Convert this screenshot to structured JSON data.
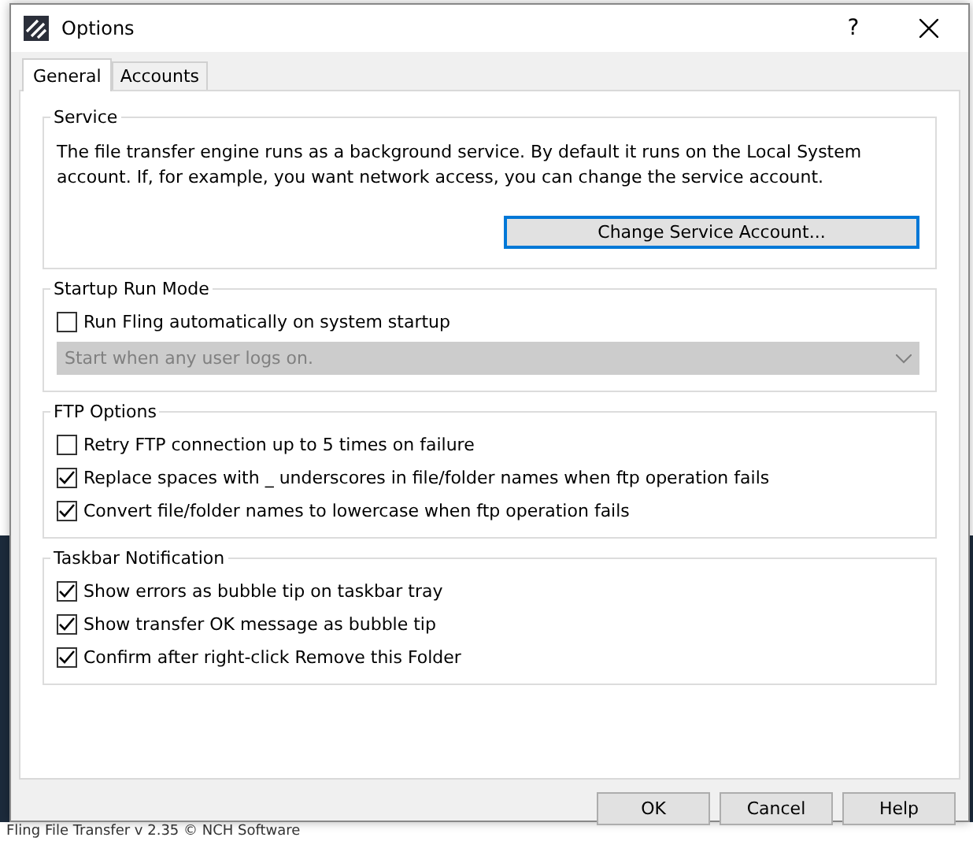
{
  "background_window": {
    "status_text": "Fling File Transfer v 2.35 © NCH Software"
  },
  "window": {
    "title": "Options",
    "help": "?"
  },
  "tabs": [
    {
      "label": "General",
      "selected": true
    },
    {
      "label": "Accounts",
      "selected": false
    }
  ],
  "service": {
    "title": "Service",
    "description": "The file transfer engine runs as a background service. By default it runs on the Local System account. If, for example, you want network access, you can change the service account.",
    "button": "Change Service Account..."
  },
  "startup": {
    "title": "Startup Run Mode",
    "option": {
      "label": "Run Fling automatically on system startup",
      "checked": false
    },
    "dropdown": {
      "value": "Start when any user logs on.",
      "disabled": true
    }
  },
  "ftp_options": {
    "title": "FTP Options",
    "options": [
      {
        "label": "Retry FTP connection up to 5 times on failure",
        "checked": false
      },
      {
        "label": "Replace spaces with _ underscores in file/folder names when ftp operation fails",
        "checked": true
      },
      {
        "label": "Convert file/folder names to lowercase when ftp operation fails",
        "checked": true
      }
    ]
  },
  "taskbar_notification": {
    "title": "Taskbar Notification",
    "options": [
      {
        "label": "Show errors as bubble tip on taskbar tray",
        "checked": true
      },
      {
        "label": "Show transfer OK message as bubble tip",
        "checked": true
      },
      {
        "label": "Confirm after right-click Remove this Folder",
        "checked": true
      }
    ]
  },
  "buttons": [
    "OK",
    "Cancel",
    "Help"
  ]
}
